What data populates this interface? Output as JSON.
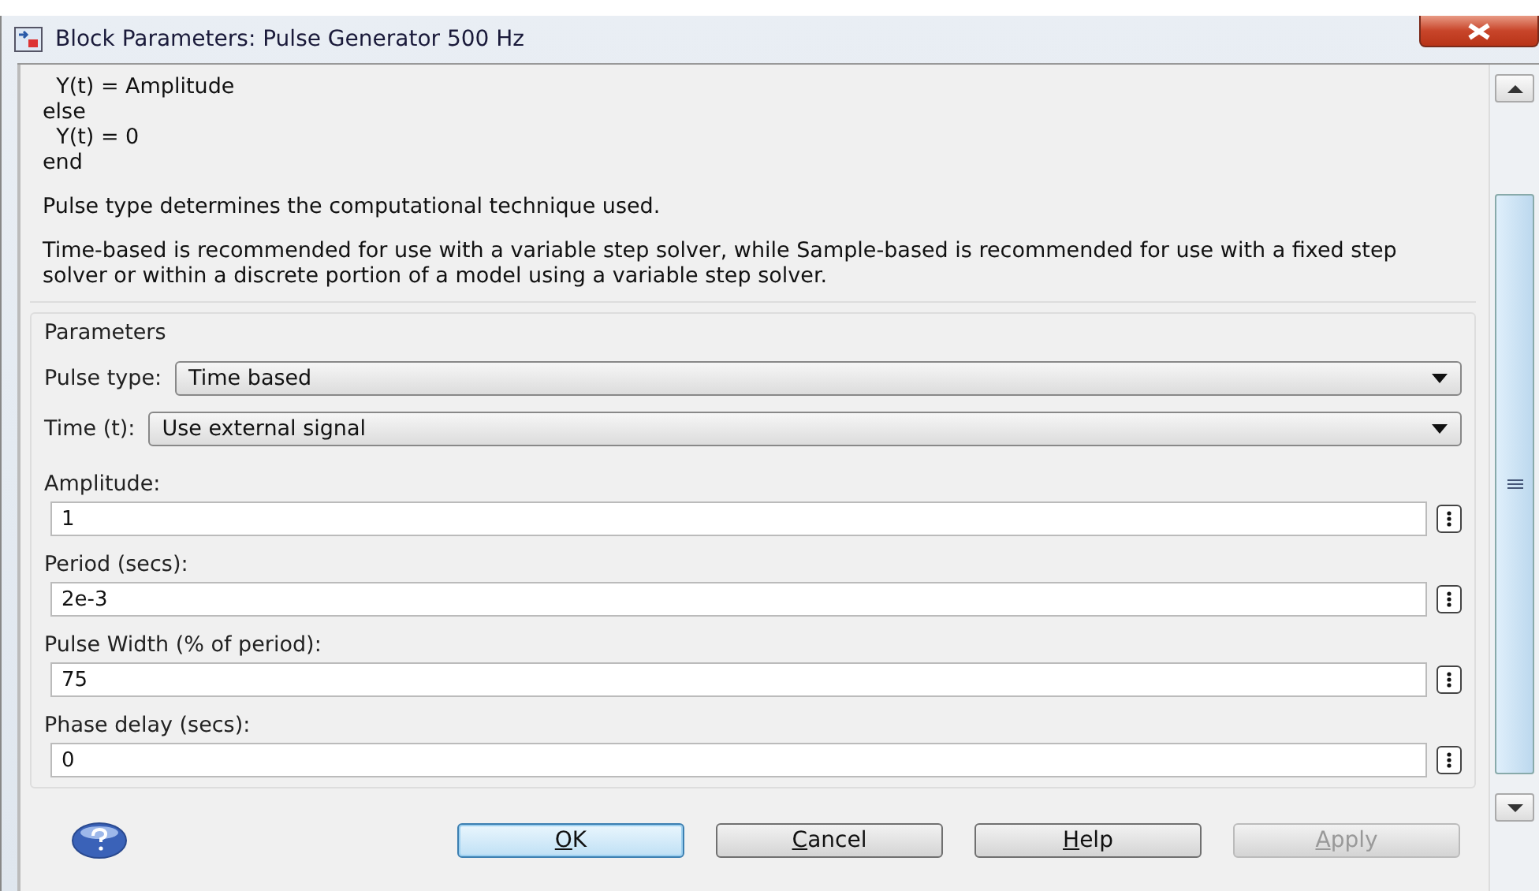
{
  "window": {
    "title": "Block Parameters: Pulse Generator 500 Hz"
  },
  "description": {
    "code_lines": [
      "  Y(t) = Amplitude",
      "else",
      "  Y(t) = 0",
      "end"
    ],
    "paragraphs": [
      "Pulse type determines the computational technique used.",
      "Time-based is recommended for use with a variable step solver, while Sample-based is recommended for use with a fixed step solver or within a discrete portion of a model using a variable step solver."
    ]
  },
  "parameters": {
    "title": "Parameters",
    "popups": [
      {
        "label": "Pulse type:",
        "value": "Time based"
      },
      {
        "label": "Time (t):",
        "value": "Use external signal"
      }
    ],
    "fields": [
      {
        "label": "Amplitude:",
        "value": "1"
      },
      {
        "label": "Period (secs):",
        "value": "2e-3"
      },
      {
        "label": "Pulse Width (% of period):",
        "value": "75"
      },
      {
        "label": "Phase delay (secs):",
        "value": "0"
      }
    ]
  },
  "buttons": [
    {
      "label": "OK",
      "disabled": false,
      "default": true
    },
    {
      "label": "Cancel",
      "disabled": false,
      "default": false
    },
    {
      "label": "Help",
      "disabled": false,
      "default": false
    },
    {
      "label": "Apply",
      "disabled": true,
      "default": false
    }
  ]
}
